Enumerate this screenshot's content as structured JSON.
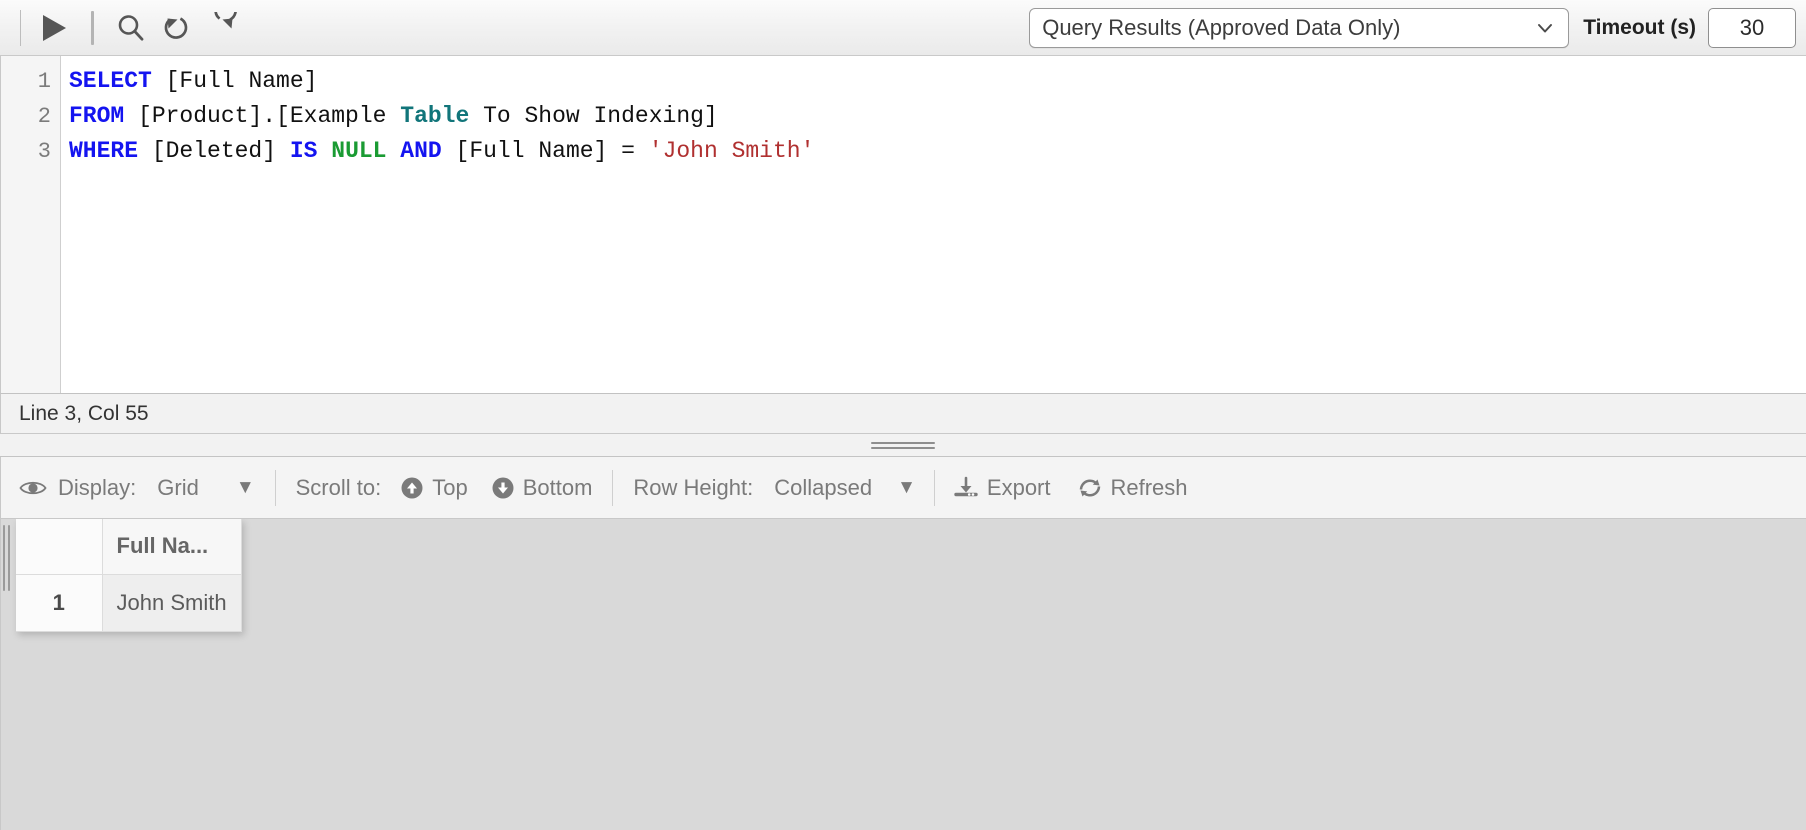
{
  "toolbar": {
    "run_icon": "play-icon",
    "search_icon": "search-icon",
    "undo_icon": "undo-icon",
    "redo_icon": "redo-icon",
    "result_mode_selected": "Query Results (Approved Data Only)",
    "result_mode_options": [
      "Query Results (Approved Data Only)"
    ],
    "timeout_label": "Timeout (s)",
    "timeout_value": "30"
  },
  "editor": {
    "line_numbers": [
      "1",
      "2",
      "3"
    ],
    "lines": [
      [
        {
          "t": "SELECT",
          "c": "kw"
        },
        {
          "t": " [Full Name]",
          "c": "plain"
        }
      ],
      [
        {
          "t": "FROM",
          "c": "kw"
        },
        {
          "t": " [Product].[Example ",
          "c": "plain"
        },
        {
          "t": "Table",
          "c": "type"
        },
        {
          "t": " To Show Indexing]",
          "c": "plain"
        }
      ],
      [
        {
          "t": "WHERE",
          "c": "kw"
        },
        {
          "t": " [Deleted] ",
          "c": "plain"
        },
        {
          "t": "IS",
          "c": "kw"
        },
        {
          "t": " ",
          "c": "plain"
        },
        {
          "t": "NULL",
          "c": "null"
        },
        {
          "t": " ",
          "c": "plain"
        },
        {
          "t": "AND",
          "c": "kw"
        },
        {
          "t": " [Full Name] = ",
          "c": "plain"
        },
        {
          "t": "'John Smith'",
          "c": "str"
        }
      ]
    ]
  },
  "status": {
    "caret_position": "Line 3, Col 55"
  },
  "results_toolbar": {
    "display_icon": "eye-icon",
    "display_label": "Display:",
    "display_value": "Grid",
    "display_caret": "▼",
    "scroll_label": "Scroll to:",
    "scroll_top_icon": "circle-arrow-up-icon",
    "scroll_top_label": "Top",
    "scroll_bottom_icon": "circle-arrow-down-icon",
    "scroll_bottom_label": "Bottom",
    "row_height_label": "Row Height:",
    "row_height_value": "Collapsed",
    "row_height_caret": "▼",
    "export_icon": "download-icon",
    "export_label": "Export",
    "refresh_icon": "refresh-icon",
    "refresh_label": "Refresh"
  },
  "results_grid": {
    "columns": [
      "Full Na..."
    ],
    "rows": [
      {
        "number": "1",
        "cells": [
          "John Smith"
        ]
      }
    ]
  },
  "colors": {
    "keyword": "#1414f0",
    "type": "#11757a",
    "null_literal": "#1a9b33",
    "string_literal": "#b03030",
    "toolbar_bg": "#f1f1f1",
    "results_bg": "#d9d9d9"
  }
}
